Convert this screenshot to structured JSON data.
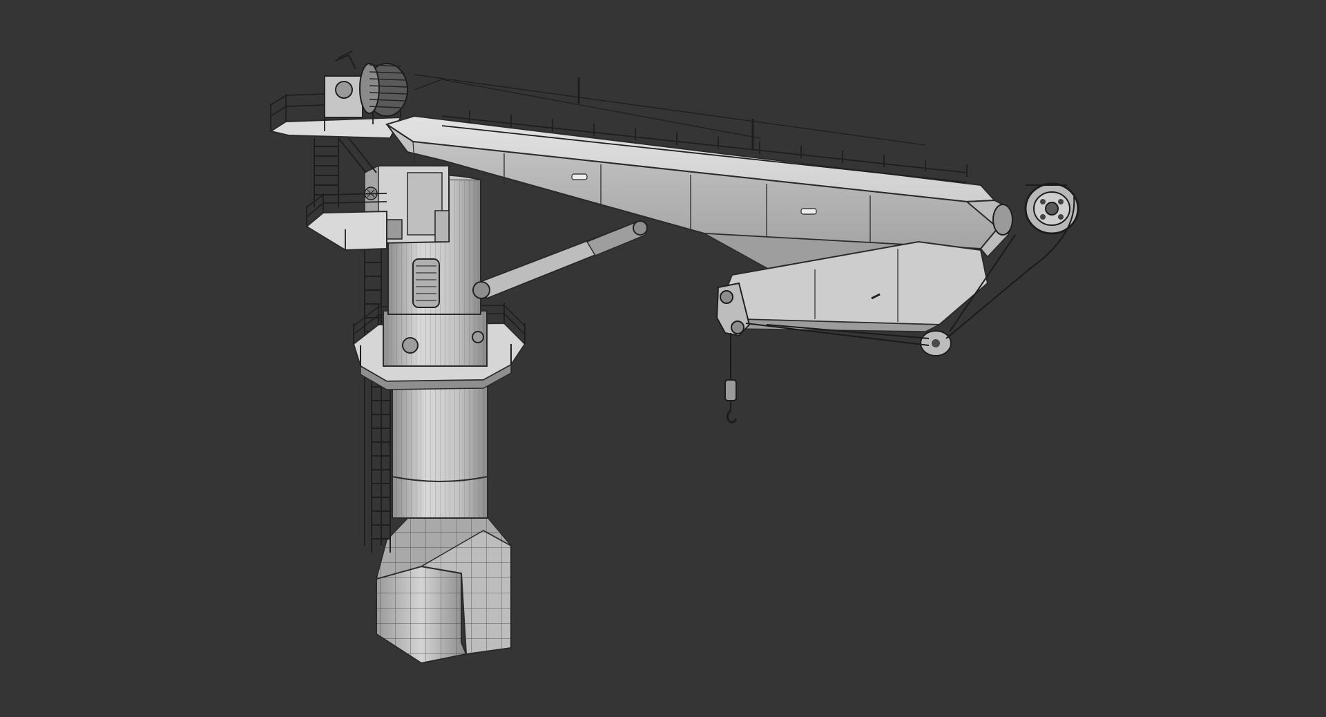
{
  "scene": {
    "subject": "offshore-pedestal-crane-wireframe-render",
    "background_color": "#353535",
    "surface_color": "#cfcfcf",
    "surface_light": "#e6e6e6",
    "surface_shadow": "#9a9a9a",
    "wire_color": "#2a2a2a",
    "rail_color": "#1e1e1e"
  }
}
